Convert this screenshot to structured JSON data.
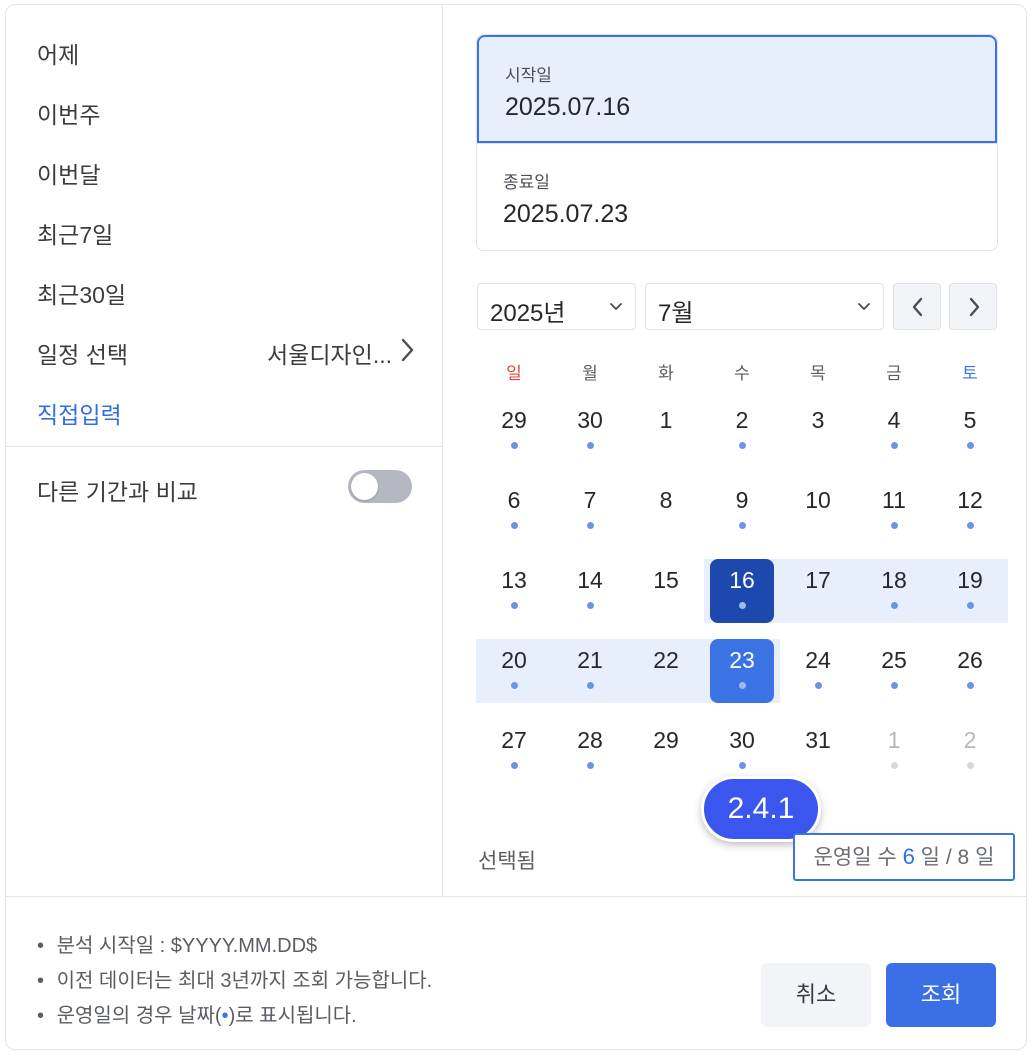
{
  "presets": [
    {
      "label": "어제"
    },
    {
      "label": "이번주"
    },
    {
      "label": "이번달"
    },
    {
      "label": "최근7일"
    },
    {
      "label": "최근30일"
    }
  ],
  "schedule": {
    "label": "일정 선택",
    "value": "서울디자인..."
  },
  "direct_input": {
    "label": "직접입력"
  },
  "compare": {
    "label": "다른 기간과 비교",
    "enabled": false
  },
  "start_date": {
    "label": "시작일",
    "value": "2025.07.16"
  },
  "end_date": {
    "label": "종료일",
    "value": "2025.07.23"
  },
  "year_select": {
    "value": "2025년"
  },
  "month_select": {
    "value": "7월"
  },
  "weekdays": [
    "일",
    "월",
    "화",
    "수",
    "목",
    "금",
    "토"
  ],
  "calendar": {
    "weeks": [
      [
        {
          "n": "29",
          "dot": true,
          "muted": false
        },
        {
          "n": "30",
          "dot": true,
          "muted": false
        },
        {
          "n": "1",
          "dot": false,
          "muted": false
        },
        {
          "n": "2",
          "dot": true,
          "muted": false
        },
        {
          "n": "3",
          "dot": false,
          "muted": false
        },
        {
          "n": "4",
          "dot": true,
          "muted": false
        },
        {
          "n": "5",
          "dot": true,
          "muted": false
        }
      ],
      [
        {
          "n": "6",
          "dot": true,
          "muted": false
        },
        {
          "n": "7",
          "dot": true,
          "muted": false
        },
        {
          "n": "8",
          "dot": false,
          "muted": false
        },
        {
          "n": "9",
          "dot": true,
          "muted": false
        },
        {
          "n": "10",
          "dot": false,
          "muted": false
        },
        {
          "n": "11",
          "dot": true,
          "muted": false
        },
        {
          "n": "12",
          "dot": true,
          "muted": false
        }
      ],
      [
        {
          "n": "13",
          "dot": true,
          "muted": false
        },
        {
          "n": "14",
          "dot": true,
          "muted": false
        },
        {
          "n": "15",
          "dot": false,
          "muted": false
        },
        {
          "n": "16",
          "dot": true,
          "muted": false,
          "state": "start"
        },
        {
          "n": "17",
          "dot": false,
          "muted": false
        },
        {
          "n": "18",
          "dot": true,
          "muted": false
        },
        {
          "n": "19",
          "dot": true,
          "muted": false
        }
      ],
      [
        {
          "n": "20",
          "dot": true,
          "muted": false
        },
        {
          "n": "21",
          "dot": true,
          "muted": false
        },
        {
          "n": "22",
          "dot": false,
          "muted": false
        },
        {
          "n": "23",
          "dot": true,
          "muted": false,
          "state": "end"
        },
        {
          "n": "24",
          "dot": true,
          "muted": false
        },
        {
          "n": "25",
          "dot": true,
          "muted": false
        },
        {
          "n": "26",
          "dot": true,
          "muted": false
        }
      ],
      [
        {
          "n": "27",
          "dot": true,
          "muted": false
        },
        {
          "n": "28",
          "dot": true,
          "muted": false
        },
        {
          "n": "29",
          "dot": false,
          "muted": false
        },
        {
          "n": "30",
          "dot": true,
          "muted": false
        },
        {
          "n": "31",
          "dot": false,
          "muted": false
        },
        {
          "n": "1",
          "dot": true,
          "muted": true
        },
        {
          "n": "2",
          "dot": true,
          "muted": true
        }
      ]
    ]
  },
  "version_badge": "2.4.1",
  "selected_label": "선택됨",
  "operating_days": {
    "prefix": "운영일 수",
    "count": "6",
    "unit": "일",
    "separator": "/",
    "total": "8",
    "unit2": "일"
  },
  "notes": [
    {
      "bullet": "•",
      "text": "분석 시작일 : $YYYY.MM.DD$"
    },
    {
      "bullet": "•",
      "text": "이전 데이터는 최대 3년까지 조회 가능합니다."
    },
    {
      "bullet": "•",
      "pre": "운영일의 경우 날짜(",
      "dot": "•",
      "post": ")로 표시됩니다."
    }
  ],
  "buttons": {
    "cancel": "취소",
    "submit": "조회"
  },
  "colors": {
    "accent": "#3b73e4",
    "start_selected": "#1d48ad",
    "range_band": "#e8effc",
    "badge": "#3b55ef"
  }
}
